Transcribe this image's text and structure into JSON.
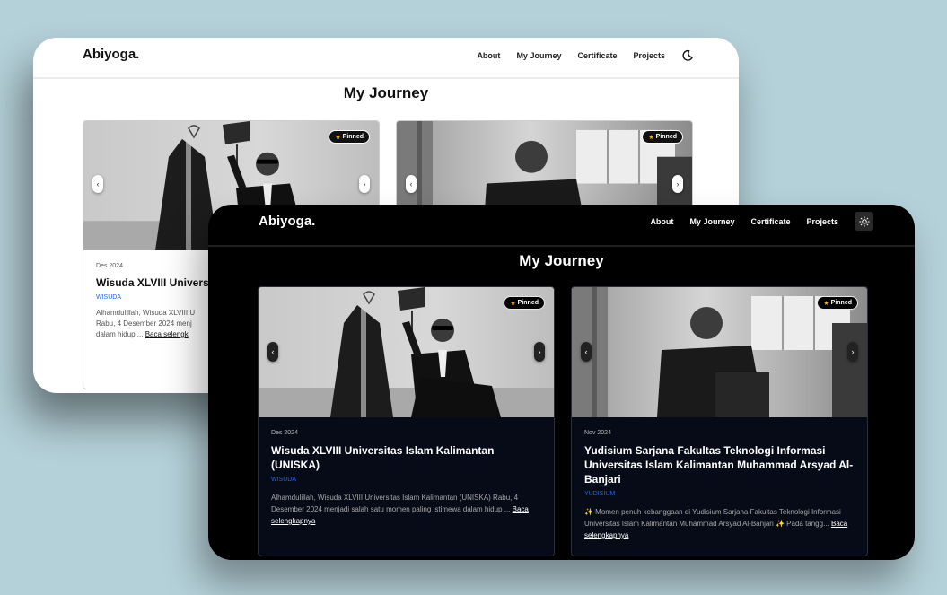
{
  "brand": "Abiyoga.",
  "nav": {
    "about": "About",
    "journey": "My Journey",
    "certificate": "Certificate",
    "projects": "Projects"
  },
  "page_title": "My Journey",
  "pinned_label": "Pinned",
  "arrows": {
    "prev": "‹",
    "next": "›"
  },
  "read_more": "Baca selengkapnya",
  "theme_icons": {
    "light_window": "moon-icon",
    "dark_window": "sun-icon"
  },
  "light_card": {
    "date": "Des 2024",
    "title": "Wisuda XLVIII Universit",
    "tag": "WISUDA",
    "desc_line1": "Alhamdulillah, Wisuda XLVIII U",
    "desc_line2": "Rabu, 4 Desember 2024 menj",
    "desc_line3": "dalam hidup ...",
    "read_more": "Baca selengk"
  },
  "cards": [
    {
      "date": "Des 2024",
      "title": "Wisuda XLVIII Universitas Islam Kalimantan (UNISKA)",
      "tag": "WISUDA",
      "desc": "Alhamdulillah, Wisuda XLVIII Universitas Islam Kalimantan (UNISKA) Rabu, 4 Desember 2024 menjadi salah satu momen paling istimewa dalam hidup ..."
    },
    {
      "date": "Nov 2024",
      "title": "Yudisium Sarjana Fakultas Teknologi Informasi Universitas Islam Kalimantan Muhammad Arsyad Al-Banjari",
      "tag": "YUDISIUM",
      "desc": "✨ Momen penuh kebanggaan di Yudisium Sarjana Fakultas Teknologi Informasi Universitas Islam Kalimantan Muhammad Arsyad Al-Banjari ✨ Pada tangg..."
    }
  ],
  "colors": {
    "background": "#b4d0d8",
    "tag": "#2563eb",
    "dark_card": "#060b17"
  }
}
